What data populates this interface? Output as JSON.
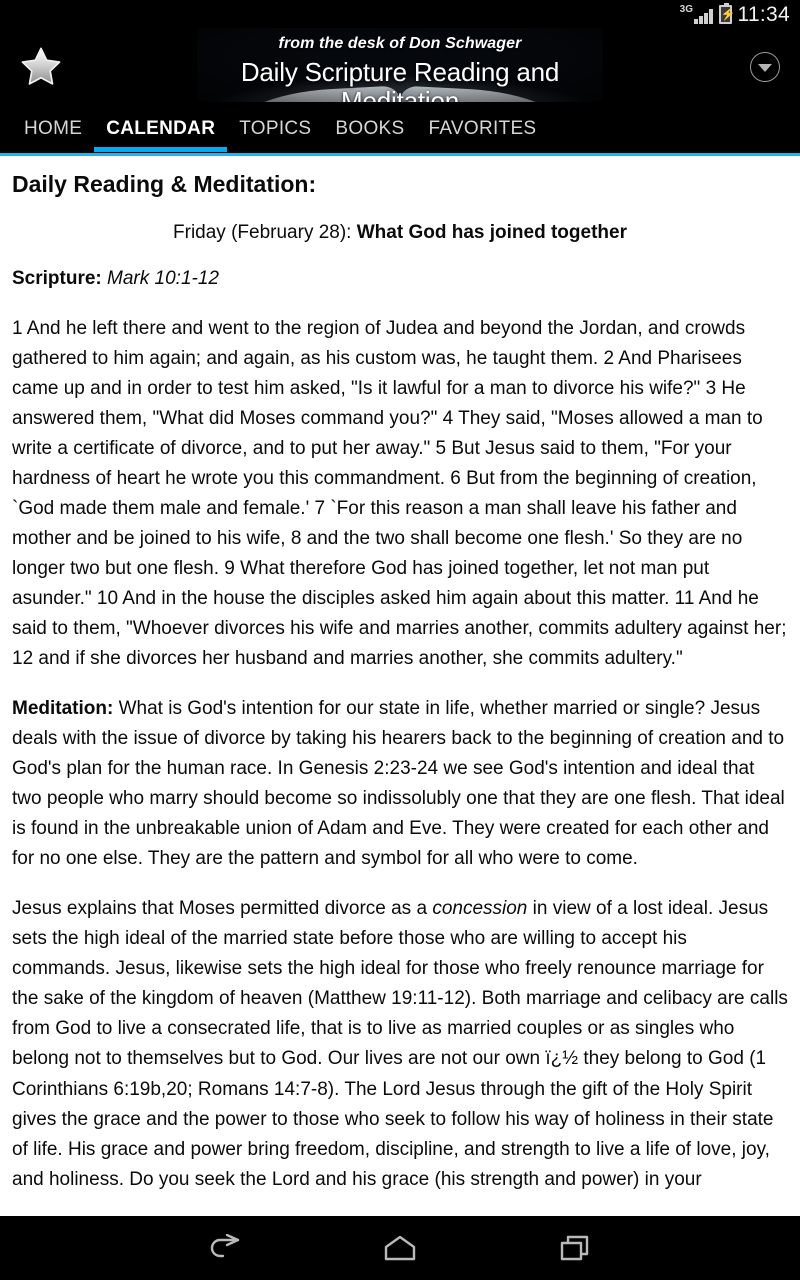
{
  "status_bar": {
    "network_label": "3G",
    "signal_icon": "signal-bars-icon",
    "battery_icon": "battery-charging-icon",
    "time": "11:34"
  },
  "header": {
    "favorite_icon": "star-icon",
    "overflow_icon": "chevron-down-circle-icon",
    "banner": {
      "subtitle": "from the desk of Don Schwager",
      "title": "Daily Scripture Reading and Meditation",
      "image": "open-book-image"
    }
  },
  "tabs": {
    "active_index": 1,
    "accent_color": "#00aeef",
    "items": [
      {
        "label": "HOME"
      },
      {
        "label": "CALENDAR"
      },
      {
        "label": "TOPICS"
      },
      {
        "label": "BOOKS"
      },
      {
        "label": "FAVORITES"
      }
    ]
  },
  "content": {
    "page_title": "Daily Reading & Meditation:",
    "dateline": {
      "date": "Friday (February 28): ",
      "title": "What God has joined together"
    },
    "scripture": {
      "label": "Scripture:",
      "reference": " Mark 10:1-12"
    },
    "scripture_text": "1 And he left there and went to the region of Judea and beyond the Jordan, and crowds gathered to him again; and again, as his custom was, he taught them. 2 And Pharisees came up and in order to test him asked, \"Is it lawful for a man to divorce his wife?\" 3 He answered them, \"What did Moses command you?\" 4 They said, \"Moses allowed a man to write a certificate of divorce, and to put her away.\" 5 But Jesus said to them, \"For your hardness of heart he wrote you this commandment. 6 But from the beginning of creation, `God made them male and female.' 7 `For this reason a man shall leave his father and mother and be joined to his wife, 8 and the two shall become one flesh.' So they are no longer two but one flesh. 9 What therefore God has joined together, let not man put asunder.\" 10 And in the house the disciples asked him again about this matter. 11 And he said to them, \"Whoever divorces his wife and marries another, commits adultery against her; 12 and if she divorces her husband and marries another, she commits adultery.\"",
    "meditation": {
      "label": "Meditation:",
      "text": " What is God's intention for our state in life, whether married or single? Jesus deals with the issue of divorce by taking his hearers back to the beginning of creation and to God's plan for the human race. In Genesis 2:23-24 we see God's intention and ideal that two people who marry should become so indissolubly one that they are one flesh. That ideal is found in the unbreakable union of Adam and Eve. They were created for each other and for no one else. They are the pattern and symbol for all who were to come."
    },
    "paragraph_3_part1": "Jesus explains that Moses permitted divorce as a ",
    "paragraph_3_italic": "concession",
    "paragraph_3_part2": " in view of a lost ideal. Jesus sets the high ideal of the married state before those who are willing to accept his commands. Jesus, likewise sets the high ideal for those who freely renounce marriage for the sake of the kingdom of heaven (Matthew 19:11-12). Both marriage and celibacy are calls from God to live a consecrated life, that is to live as married couples or as singles who belong not to themselves but to God. Our lives are not our own ï¿½ they belong to God (1 Corinthians 6:19b,20; Romans 14:7-8). The Lord Jesus through the gift of the Holy Spirit gives the grace and the power to those who seek to follow his way of holiness in their state of life. His grace and power bring freedom, discipline, and strength to live a life of love, joy, and holiness. Do you seek the Lord and his grace (his strength and power) in your"
  },
  "nav_bar": {
    "back_icon": "back-arrow-icon",
    "home_icon": "home-icon",
    "recents_icon": "recent-apps-icon"
  }
}
